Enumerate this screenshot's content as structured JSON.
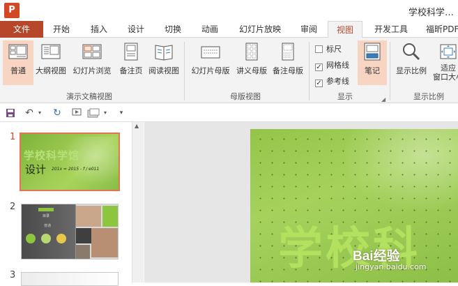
{
  "titlebar": {
    "logo": "P",
    "doc_title": "学校科学…"
  },
  "tabs": [
    {
      "label": "文件"
    },
    {
      "label": "开始"
    },
    {
      "label": "插入"
    },
    {
      "label": "设计"
    },
    {
      "label": "切换"
    },
    {
      "label": "动画"
    },
    {
      "label": "幻灯片放映"
    },
    {
      "label": "审阅"
    },
    {
      "label": "视图"
    },
    {
      "label": "开发工具"
    },
    {
      "label": "福昕PDF"
    }
  ],
  "active_tab": "视图",
  "ribbon": {
    "presentation_views": {
      "group_label": "演示文稿视图",
      "normal": "普通",
      "outline": "大纲视图",
      "slide_sorter": "幻灯片浏览",
      "notes_page": "备注页",
      "reading": "阅读视图"
    },
    "master_views": {
      "group_label": "母版视图",
      "slide_master": "幻灯片母版",
      "handout_master": "讲义母版",
      "notes_master": "备注母版"
    },
    "show": {
      "group_label": "显示",
      "ruler": "标尺",
      "gridlines": "网格线",
      "guides": "参考线",
      "notes": "笔记",
      "ruler_checked": false,
      "gridlines_checked": true,
      "guides_checked": true
    },
    "zoom": {
      "group_label": "显示比例",
      "zoom": "显示比例",
      "fit_to_window": "适应\n窗口大小"
    }
  },
  "thumbnails": [
    {
      "number": "1",
      "title": "学校科学馆",
      "subtitle": "设计",
      "formula": "201x = 2015 - f / e011"
    },
    {
      "number": "2",
      "heading": "目录",
      "caption": "普通"
    },
    {
      "number": "3"
    }
  ],
  "slide": {
    "big_text": "学校科"
  },
  "watermark": {
    "logo": "Bai经验",
    "url": "jingyan.baidu.com"
  },
  "colors": {
    "accent": "#b7472a",
    "selected": "#f8d4c3",
    "slide_green": "#8cc63f"
  }
}
